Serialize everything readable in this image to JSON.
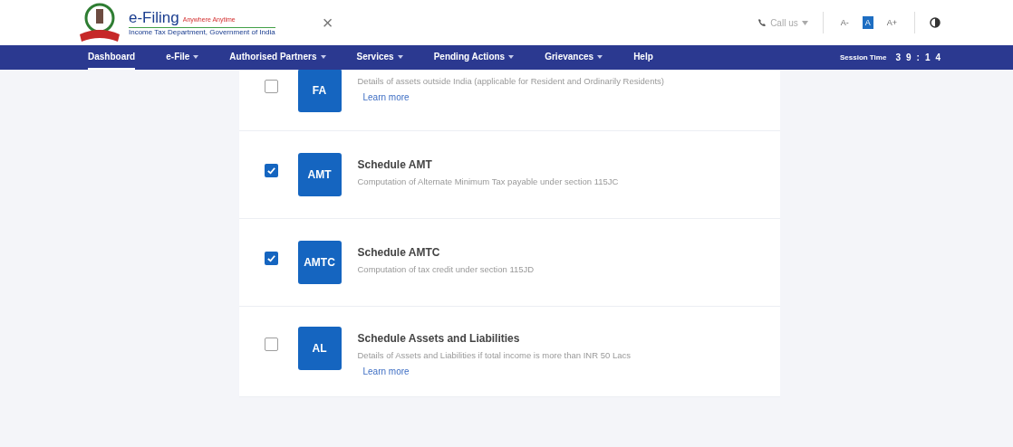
{
  "header": {
    "logo_title": "e-Filing",
    "logo_tagline": "Anywhere Anytime",
    "logo_subtitle": "Income Tax Department, Government of India",
    "close": "×",
    "call_us": "Call us",
    "font_sizes": [
      {
        "label": "A-",
        "selected": false
      },
      {
        "label": "A",
        "selected": true
      },
      {
        "label": "A+",
        "selected": false
      }
    ]
  },
  "nav": {
    "items": [
      {
        "label": "Dashboard",
        "selected": true,
        "dropdown": false
      },
      {
        "label": "e-File",
        "selected": false,
        "dropdown": true
      },
      {
        "label": "Authorised Partners",
        "selected": false,
        "dropdown": true
      },
      {
        "label": "Services",
        "selected": false,
        "dropdown": true
      },
      {
        "label": "Pending Actions",
        "selected": false,
        "dropdown": true
      },
      {
        "label": "Grievances",
        "selected": false,
        "dropdown": true
      },
      {
        "label": "Help",
        "selected": false,
        "dropdown": false
      }
    ],
    "session_label": "Session Time",
    "session_digits": [
      "3",
      "9",
      ":",
      "1",
      "4"
    ]
  },
  "schedules": [
    {
      "code": "FA",
      "description": "Details of assets outside India (applicable for Resident and Ordinarily Residents)",
      "learn_more": "Learn more",
      "checked": false
    },
    {
      "code": "AMT",
      "title": "Schedule AMT",
      "description": "Computation of Alternate Minimum Tax payable under section 115JC",
      "checked": true
    },
    {
      "code": "AMTC",
      "title": "Schedule AMTC",
      "description": "Computation of tax credit under section 115JD",
      "checked": true
    },
    {
      "code": "AL",
      "title": "Schedule Assets and Liabilities",
      "description": "Details of Assets and Liabilities if total income is more than INR 50 Lacs",
      "learn_more": "Learn more",
      "checked": false
    }
  ]
}
